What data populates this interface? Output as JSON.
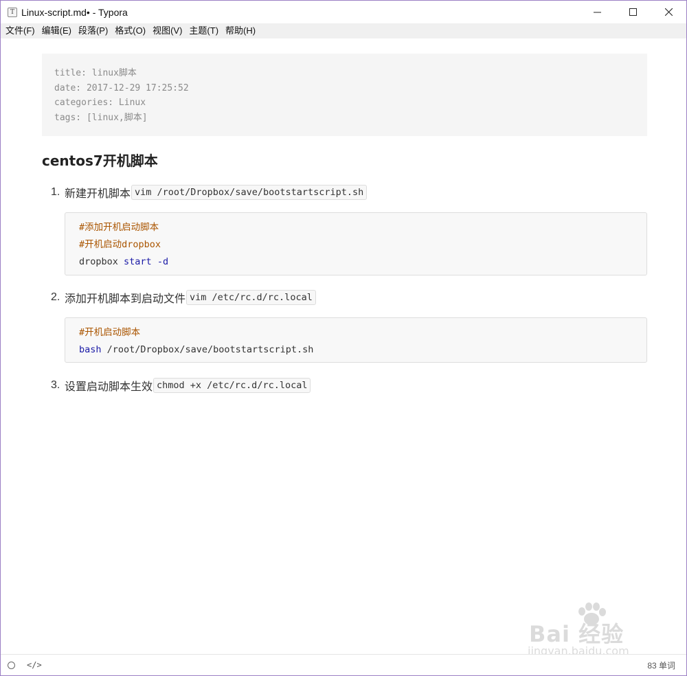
{
  "window": {
    "title": "Linux-script.md• - Typora",
    "app_icon_letter": "T"
  },
  "menu": [
    "文件(F)",
    "编辑(E)",
    "段落(P)",
    "格式(O)",
    "视图(V)",
    "主题(T)",
    "帮助(H)"
  ],
  "frontmatter": [
    "title: linux脚本",
    "date: 2017-12-29 17:25:52",
    "categories: Linux",
    "tags: [linux,脚本]"
  ],
  "heading": "centos7开机脚本",
  "steps": [
    {
      "num": "1.",
      "text": "新建开机脚本",
      "code": "vim /root/Dropbox/save/bootstartscript.sh"
    },
    {
      "num": "2.",
      "text": "添加开机脚本到启动文件",
      "code": "vim /etc/rc.d/rc.local"
    },
    {
      "num": "3.",
      "text": "设置启动脚本生效",
      "code": "chmod +x /etc/rc.d/rc.local"
    }
  ],
  "code_block_1": {
    "comment_1": "#添加开机启动脚本",
    "comment_2": "#开机启动dropbox",
    "cmd": "dropbox",
    "keyword": "start",
    "flag": "-d"
  },
  "code_block_2": {
    "comment_1": "#开机启动脚本",
    "keyword": "bash",
    "path": "/root/Dropbox/save/bootstartscript.sh"
  },
  "status": {
    "source_toggle": "</>",
    "word_count": "83 单词"
  },
  "watermark": {
    "main": "Bai 经验",
    "sub": "jingyan.baidu.com"
  },
  "colors": {
    "comment": "#aa5500",
    "keyword": "#1a1aa6",
    "window_border": "#9b7fc4"
  }
}
